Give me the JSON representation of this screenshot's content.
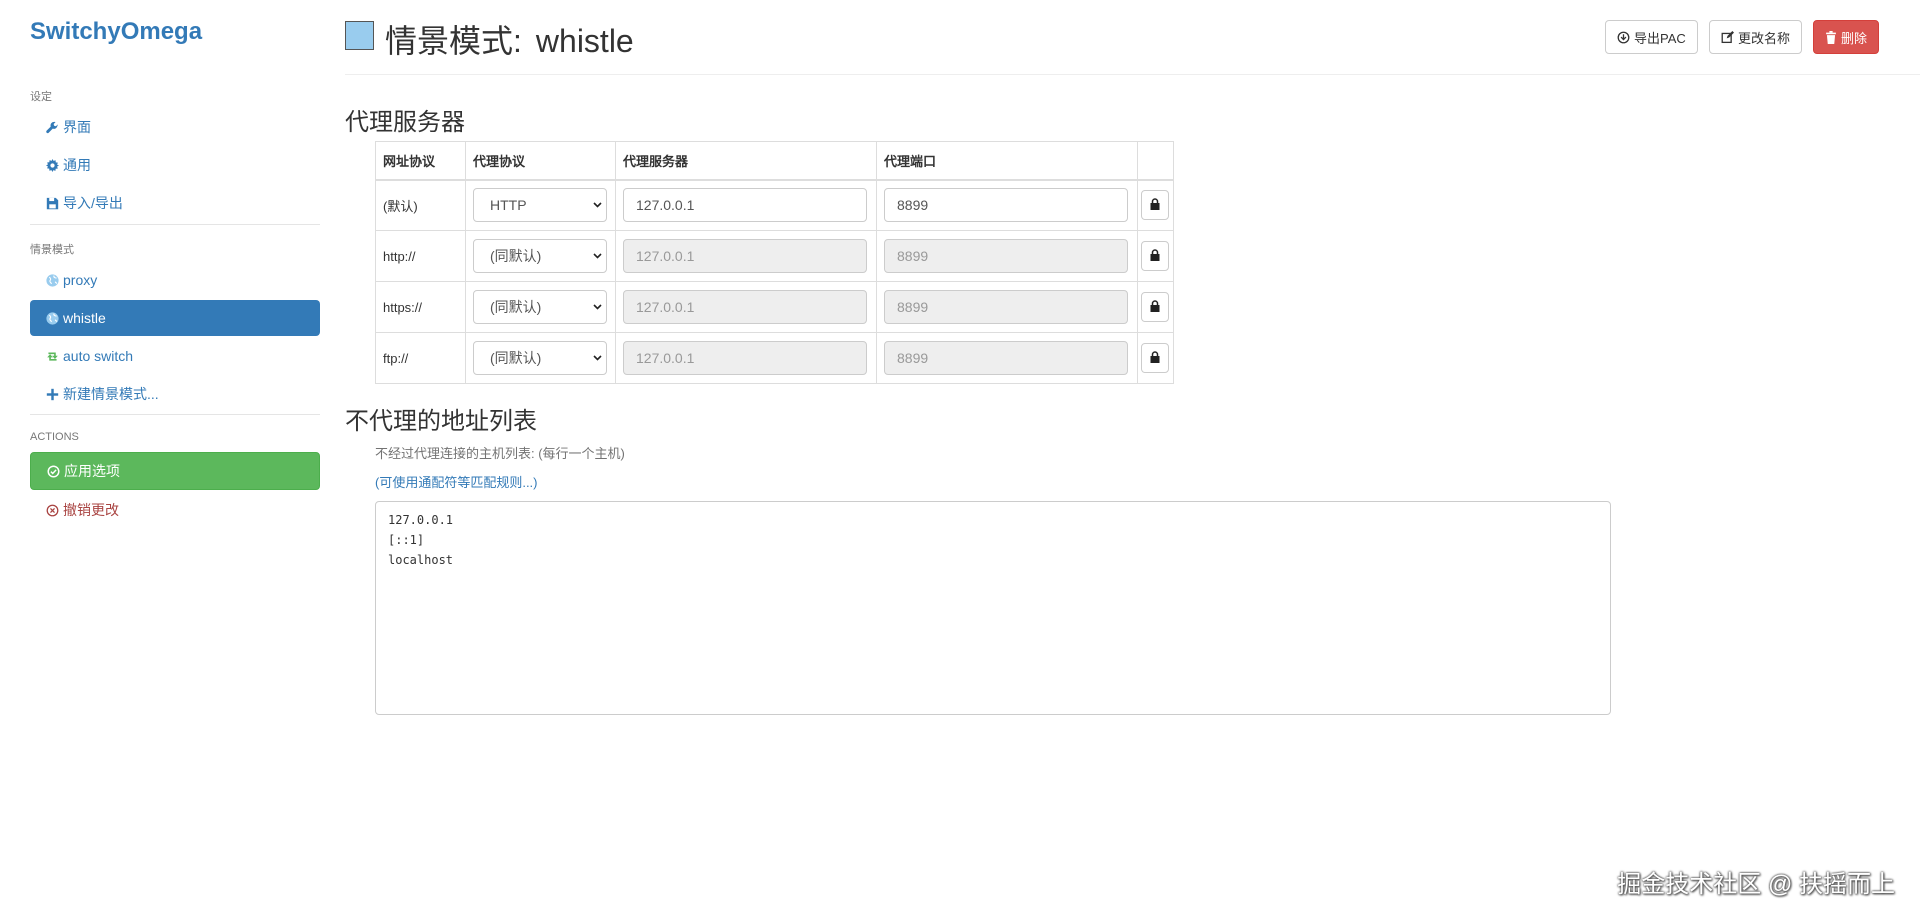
{
  "sidebar": {
    "brand": "SwitchyOmega",
    "settings_header": "设定",
    "settings_items": [
      {
        "label": "界面",
        "icon": "wrench-icon"
      },
      {
        "label": "通用",
        "icon": "gear-icon"
      },
      {
        "label": "导入/导出",
        "icon": "floppy-icon"
      }
    ],
    "profiles_header": "情景模式",
    "profiles": [
      {
        "label": "proxy",
        "icon": "globe-icon"
      },
      {
        "label": "whistle",
        "icon": "globe-icon",
        "active": true
      },
      {
        "label": "auto switch",
        "icon": "retweet-icon"
      },
      {
        "label": "新建情景模式...",
        "icon": "plus-icon"
      }
    ],
    "actions_header": "ACTIONS",
    "actions": [
      {
        "label": "应用选项",
        "icon": "check-circle-icon"
      },
      {
        "label": "撤销更改",
        "icon": "x-circle-icon"
      }
    ]
  },
  "header": {
    "title_prefix": "情景模式:",
    "profile_name": "whistle",
    "profile_color": "#99ccee",
    "export_pac": "导出PAC",
    "rename": "更改名称",
    "delete": "删除"
  },
  "proxy_section": {
    "title": "代理服务器",
    "columns": [
      "网址协议",
      "代理协议",
      "代理服务器",
      "代理端口"
    ],
    "rows": [
      {
        "scheme": "(默认)",
        "protocol": "HTTP",
        "host": "127.0.0.1",
        "port": "8899",
        "disabled": false
      },
      {
        "scheme": "http://",
        "protocol": "(同默认)",
        "host": "127.0.0.1",
        "port": "8899",
        "disabled": true
      },
      {
        "scheme": "https://",
        "protocol": "(同默认)",
        "host": "127.0.0.1",
        "port": "8899",
        "disabled": true
      },
      {
        "scheme": "ftp://",
        "protocol": "(同默认)",
        "host": "127.0.0.1",
        "port": "8899",
        "disabled": true
      }
    ]
  },
  "bypass_section": {
    "title": "不代理的地址列表",
    "help": "不经过代理连接的主机列表: (每行一个主机)",
    "link": "(可使用通配符等匹配规则...)",
    "list": "127.0.0.1\n[::1]\nlocalhost"
  },
  "watermark": "掘金技术社区 @ 扶摇而上",
  "colors": {
    "primary": "#337ab7",
    "success": "#5cb85c",
    "danger": "#d9534f"
  }
}
